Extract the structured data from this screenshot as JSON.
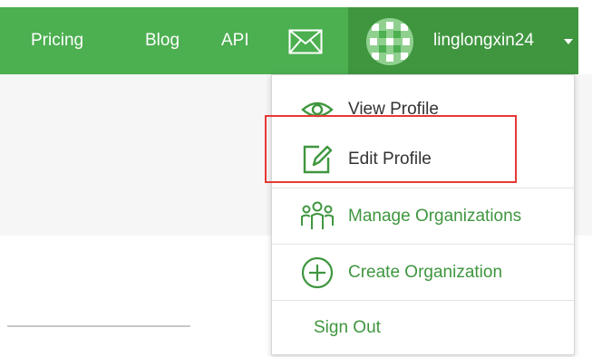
{
  "navbar": {
    "links": {
      "pricing": "Pricing",
      "blog": "Blog",
      "api": "API"
    },
    "mail_icon": "envelope-icon",
    "user": {
      "username": "linglongxin24",
      "caret_icon": "caret-down-icon"
    }
  },
  "dropdown": {
    "items": [
      {
        "label": "View Profile",
        "icon": "eye-icon"
      },
      {
        "label": "Edit Profile",
        "icon": "edit-icon"
      },
      {
        "label": "Manage Organizations",
        "icon": "people-group-icon"
      },
      {
        "label": "Create Organization",
        "icon": "plus-circle-icon"
      },
      {
        "label": "Sign Out",
        "icon": ""
      }
    ]
  },
  "colors": {
    "navbar": "#4caf50",
    "navbar_active": "#3f963f",
    "accent": "#3f963f",
    "highlight": "#e53935"
  }
}
